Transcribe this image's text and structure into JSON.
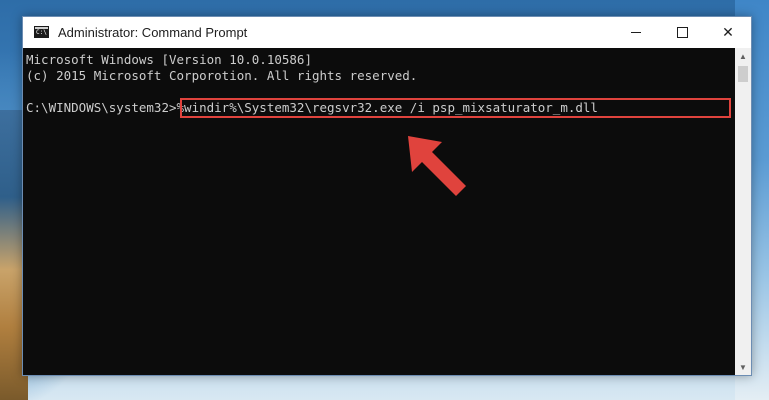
{
  "window": {
    "title": "Administrator: Command Prompt",
    "icon": "cmd-icon",
    "icon_text": "C:\\",
    "controls": {
      "minimize_icon": "minimize-icon",
      "maximize_icon": "maximize-icon",
      "close_icon": "close-icon",
      "close_glyph": "✕"
    }
  },
  "console": {
    "lines": [
      "Microsoft Windows [Version 10.0.10586]",
      "(c) 2015 Microsoft Corporotion. All rights reserved."
    ],
    "prompt": "C:\\WINDOWS\\system32>",
    "command": "%windir%\\System32\\regsvr32.exe /i psp_mixsaturator_m.dll"
  },
  "annotation": {
    "highlight_color": "#e0433d",
    "arrow_color": "#e0433d",
    "arrow_icon": "arrow-pointer-icon"
  },
  "scrollbar": {
    "up_glyph": "▲",
    "down_glyph": "▼"
  }
}
